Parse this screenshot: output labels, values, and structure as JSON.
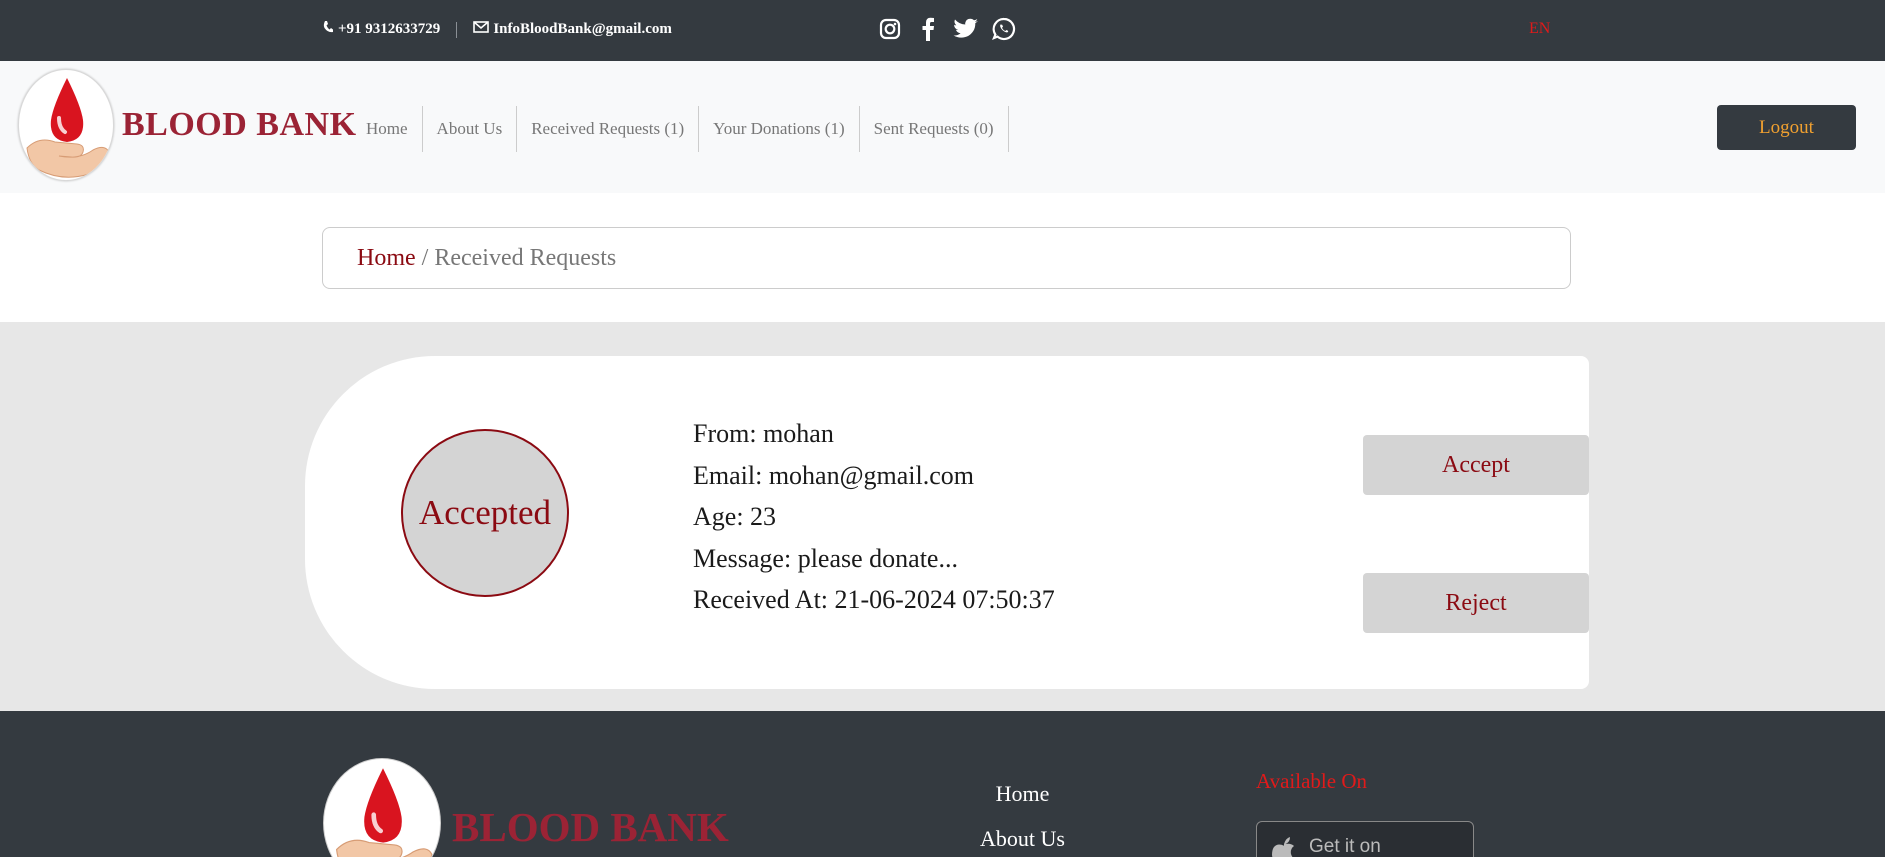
{
  "topbar": {
    "phone": "+91 9312633729",
    "email": "InfoBloodBank@gmail.com",
    "socials": [
      "instagram-icon",
      "facebook-icon",
      "twitter-icon",
      "whatsapp-icon"
    ],
    "language": "EN"
  },
  "navbar": {
    "brand": "BLOOD BANK",
    "links": [
      "Home",
      "About Us",
      "Received Requests (1)",
      "Your Donations (1)",
      "Sent Requests (0)"
    ],
    "logout": "Logout"
  },
  "breadcrumb": {
    "home": "Home",
    "current": "/ Received Requests"
  },
  "request": {
    "status": "Accepted",
    "from": "From: mohan",
    "email": "Email: mohan@gmail.com",
    "age": "Age: 23",
    "message": "Message: please donate...",
    "received_at": "Received At: 21-06-2024 07:50:37",
    "accept_label": "Accept",
    "reject_label": "Reject"
  },
  "footer": {
    "brand": "BLOOD BANK",
    "links": [
      "Home",
      "About Us"
    ],
    "available_on": "Available On",
    "store_label": "Get it on"
  },
  "colors": {
    "dark": "#343a40",
    "brand_red": "#9b2335",
    "accent_red": "#8b0a12",
    "logout_text": "#f0a030",
    "lang_red": "#e01a1a"
  }
}
